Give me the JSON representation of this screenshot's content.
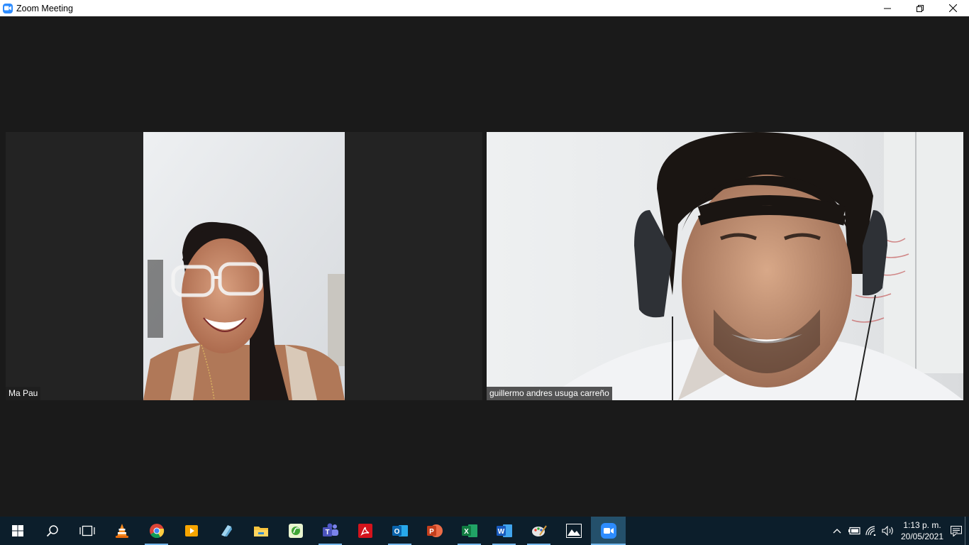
{
  "window": {
    "title": "Zoom Meeting",
    "icon": "zoom-camera-icon",
    "controls": [
      "minimize-icon",
      "restore-icon",
      "close-icon"
    ]
  },
  "participants": [
    {
      "name": "Ma Pau"
    },
    {
      "name": "guillermo andres usuga carreño"
    }
  ],
  "taskbar": {
    "apps": [
      "start-icon",
      "search-icon",
      "task-view-icon",
      "vlc-icon",
      "chrome-icon",
      "media-player-icon",
      "edge-legacy-icon",
      "file-explorer-icon",
      "green-app-icon",
      "teams-icon",
      "acrobat-icon",
      "outlook-icon",
      "powerpoint-icon",
      "excel-icon",
      "word-icon",
      "paint-icon",
      "photos-icon",
      "zoom-icon"
    ],
    "tray_icons": [
      "chevron-up-icon",
      "battery-icon",
      "wifi-icon",
      "volume-icon",
      "notification-icon"
    ],
    "time": "1:13 p. m.",
    "date": "20/05/2021"
  },
  "colors": {
    "meeting_bg": "#1a1a1a",
    "tile_bg": "#232323",
    "taskbar_bg": "#0c1e2b",
    "zoom_blue": "#2d8cff",
    "active_underline": "#76b9ed"
  }
}
